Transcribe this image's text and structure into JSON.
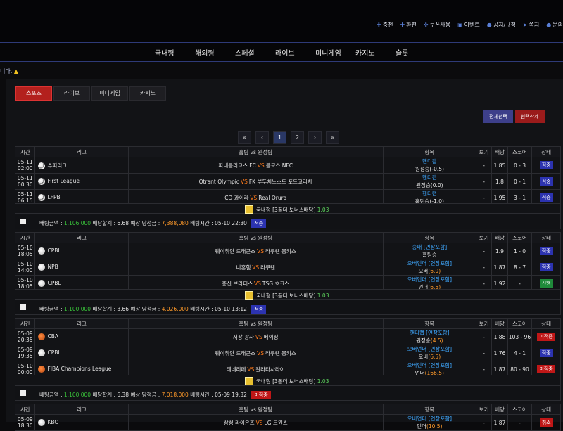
{
  "top_links": [
    {
      "icon": "plus-icon",
      "label": "충전"
    },
    {
      "icon": "minus-icon",
      "label": "환전"
    },
    {
      "icon": "gift-icon",
      "label": "쿠폰사용"
    },
    {
      "icon": "calendar-icon",
      "label": "이벤트"
    },
    {
      "icon": "info-icon",
      "label": "공지/규정"
    },
    {
      "icon": "send-icon",
      "label": "쪽지"
    },
    {
      "icon": "question-icon",
      "label": "문의"
    }
  ],
  "nav": [
    "국내형",
    "해외형",
    "스페셜",
    "라이브",
    "미니게임",
    "카지노",
    "슬롯"
  ],
  "notice": "니다.",
  "tabs": [
    "스포츠",
    "라이브",
    "미니게임",
    "카지노"
  ],
  "select_all": "전체선택",
  "delete_selected": "선택삭제",
  "pager": {
    "first": "«",
    "prev": "‹",
    "p1": "1",
    "p2": "2",
    "next": "›",
    "last": "»"
  },
  "headers": {
    "time": "시간",
    "league": "리그",
    "match": "홈팀 vs 원정팀",
    "item": "항목",
    "view": "보기",
    "odds": "배당",
    "score": "스코어",
    "status": "상태"
  },
  "vs": "VS",
  "bonus": {
    "type": "국내형",
    "label": "[3폴더 보너스배당]",
    "value": "1.03"
  },
  "groups": [
    {
      "rows": [
        {
          "sport": "soccer",
          "date": "05-11",
          "time": "02:00",
          "league": "슈퍼리그",
          "home": "파네톨리코스 FC",
          "away": "볼로스 NFC",
          "market": "핸디캡",
          "pick": "원정승(-0.5)",
          "view": "-",
          "odds": "1.85",
          "score": "0 - 3",
          "status": "적중",
          "status_type": "ok"
        },
        {
          "sport": "soccer",
          "date": "05-11",
          "time": "00:30",
          "league": "First League",
          "home": "Otrant Olympic",
          "away": "FK 부두치노스트 포드고리차",
          "market": "핸디캡",
          "pick": "원정승(0.0)",
          "view": "-",
          "odds": "1.8",
          "score": "0 - 1",
          "status": "적중",
          "status_type": "ok"
        },
        {
          "sport": "soccer",
          "date": "05-11",
          "time": "06:15",
          "league": "LFPB",
          "home": "CD 과이라",
          "away": "Real Oruro",
          "market": "핸디캡",
          "pick": "홈팀승(-1.0)",
          "view": "-",
          "odds": "1.95",
          "score": "3 - 1",
          "status": "적중",
          "status_type": "ok"
        }
      ],
      "summary": {
        "amount_label": "배팅금액 :",
        "amount": "1,106,000",
        "total_label": "배당합계 :",
        "total": "6.68",
        "win_label": "예상 당첨금 :",
        "win": "7,388,080",
        "time_label": "배팅시간 :",
        "time": "05-10 22:30",
        "badge": "적중",
        "badge_type": "ok"
      }
    },
    {
      "rows": [
        {
          "sport": "base",
          "date": "05-10",
          "time": "18:05",
          "league": "CPBL",
          "home": "웨이취안 드래곤스",
          "away": "라쿠텐 몽키스",
          "market": "승패 [연장포함]",
          "pick": "홈팀승",
          "view": "-",
          "odds": "1.9",
          "score": "1 - 0",
          "status": "적중",
          "status_type": "ok"
        },
        {
          "sport": "base",
          "date": "05-10",
          "time": "14:00",
          "league": "NPB",
          "home": "니혼햄",
          "away": "라쿠텐",
          "market": "오버언더 [연장포함]",
          "pick": "오버",
          "pick_val": "(6.0)",
          "view": "-",
          "odds": "1.87",
          "score": "8 - 7",
          "status": "적중",
          "status_type": "ok"
        },
        {
          "sport": "base",
          "date": "05-10",
          "time": "18:05",
          "league": "CPBL",
          "home": "중신 브라더스",
          "away": "TSG 호크스",
          "market": "오버언더 [연장포함]",
          "pick": "언더",
          "pick_val": "(6.5)",
          "view": "-",
          "odds": "1.92",
          "score": "-",
          "status": "진행",
          "status_type": "run"
        }
      ],
      "summary": {
        "amount_label": "배팅금액 :",
        "amount": "1,100,000",
        "total_label": "배당합계 :",
        "total": "3.66",
        "win_label": "예상 당첨금 :",
        "win": "4,026,000",
        "time_label": "배팅시간 :",
        "time": "05-10 13:12",
        "badge": "적중",
        "badge_type": "ok"
      }
    },
    {
      "rows": [
        {
          "sport": "basket",
          "date": "05-09",
          "time": "20:35",
          "league": "CBA",
          "home": "저장 광사",
          "away": "베이징",
          "market": "핸디캡 [연장포함]",
          "pick": "원정승",
          "pick_val": "(4.5)",
          "view": "-",
          "odds": "1.88",
          "score": "103 - 96",
          "status": "미적중",
          "status_type": "no"
        },
        {
          "sport": "base",
          "date": "05-09",
          "time": "19:35",
          "league": "CPBL",
          "home": "웨이취안 드래곤스",
          "away": "라쿠텐 몽키스",
          "market": "오버언더 [연장포함]",
          "pick": "오버",
          "pick_val": "(6.5)",
          "view": "-",
          "odds": "1.76",
          "score": "4 - 1",
          "status": "적중",
          "status_type": "ok"
        },
        {
          "sport": "basket",
          "date": "05-10",
          "time": "00:00",
          "league": "FIBA Champions League",
          "home": "테네리페",
          "away": "갈라타사라이",
          "market": "오버언더 [연장포함]",
          "pick": "언더",
          "pick_val": "(166.5)",
          "view": "-",
          "odds": "1.87",
          "score": "80 - 90",
          "status": "미적중",
          "status_type": "no"
        }
      ],
      "summary": {
        "amount_label": "배팅금액 :",
        "amount": "1,100,000",
        "total_label": "배당합계 :",
        "total": "6.38",
        "win_label": "예상 당첨금 :",
        "win": "7,018,000",
        "time_label": "배팅시간 :",
        "time": "05-09 19:32",
        "badge": "미적중",
        "badge_type": "no"
      }
    },
    {
      "rows": [
        {
          "sport": "base",
          "date": "05-09",
          "time": "18:30",
          "league": "KBO",
          "home": "삼성 라이온즈",
          "away": "LG 트윈스",
          "market": "오버언더 [연장포함]",
          "pick": "언더",
          "pick_val": "(10.5)",
          "view": "-",
          "odds": "1.87",
          "score": "-",
          "status": "취소",
          "status_type": "cancel"
        }
      ]
    }
  ]
}
